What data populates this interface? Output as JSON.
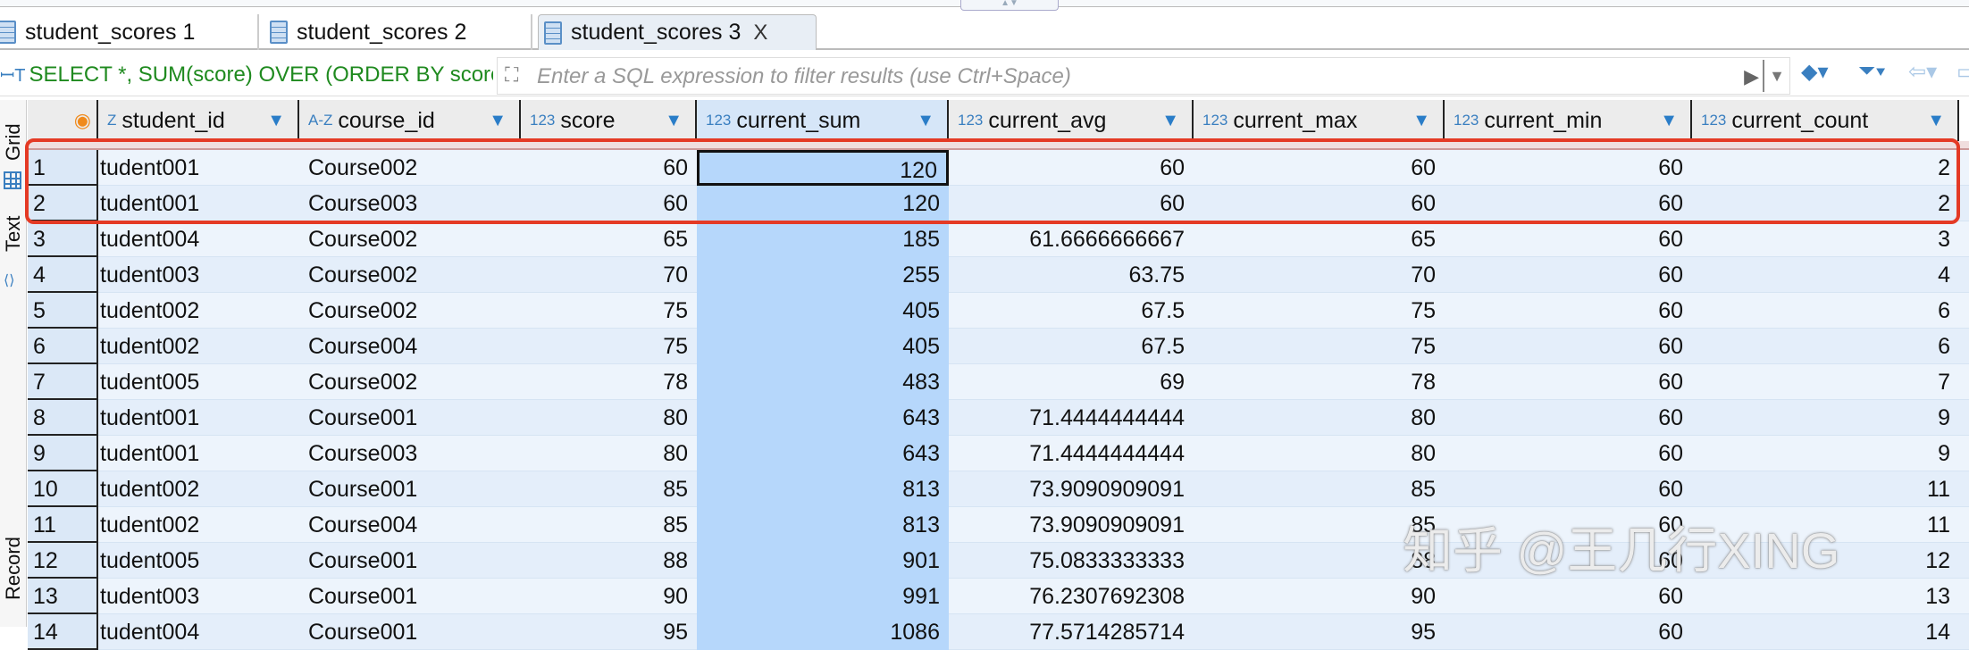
{
  "tabs": [
    {
      "label": "student_scores 1"
    },
    {
      "label": "student_scores 2"
    },
    {
      "label": "student_scores 3",
      "active": true,
      "close": "X"
    }
  ],
  "filter": {
    "sql": "SELECT *, SUM(score) OVER (ORDER BY score",
    "placeholder": "Enter a SQL expression to filter results (use Ctrl+Space)"
  },
  "sidebar": {
    "grid": "Grid",
    "text": "Text",
    "record": "Record"
  },
  "columns": [
    {
      "type": "Z",
      "name": "student_id"
    },
    {
      "type": "A-Z",
      "name": "course_id"
    },
    {
      "type": "123",
      "name": "score"
    },
    {
      "type": "123",
      "name": "current_sum"
    },
    {
      "type": "123",
      "name": "current_avg"
    },
    {
      "type": "123",
      "name": "current_max"
    },
    {
      "type": "123",
      "name": "current_min"
    },
    {
      "type": "123",
      "name": "current_count"
    }
  ],
  "rows": [
    {
      "n": "1",
      "c": [
        "tudent001",
        "Course002",
        "60",
        "120",
        "60",
        "60",
        "60",
        "2"
      ]
    },
    {
      "n": "2",
      "c": [
        "tudent001",
        "Course003",
        "60",
        "120",
        "60",
        "60",
        "60",
        "2"
      ]
    },
    {
      "n": "3",
      "c": [
        "tudent004",
        "Course002",
        "65",
        "185",
        "61.6666666667",
        "65",
        "60",
        "3"
      ]
    },
    {
      "n": "4",
      "c": [
        "tudent003",
        "Course002",
        "70",
        "255",
        "63.75",
        "70",
        "60",
        "4"
      ]
    },
    {
      "n": "5",
      "c": [
        "tudent002",
        "Course002",
        "75",
        "405",
        "67.5",
        "75",
        "60",
        "6"
      ]
    },
    {
      "n": "6",
      "c": [
        "tudent002",
        "Course004",
        "75",
        "405",
        "67.5",
        "75",
        "60",
        "6"
      ]
    },
    {
      "n": "7",
      "c": [
        "tudent005",
        "Course002",
        "78",
        "483",
        "69",
        "78",
        "60",
        "7"
      ]
    },
    {
      "n": "8",
      "c": [
        "tudent001",
        "Course001",
        "80",
        "643",
        "71.4444444444",
        "80",
        "60",
        "9"
      ]
    },
    {
      "n": "9",
      "c": [
        "tudent001",
        "Course003",
        "80",
        "643",
        "71.4444444444",
        "80",
        "60",
        "9"
      ]
    },
    {
      "n": "10",
      "c": [
        "tudent002",
        "Course001",
        "85",
        "813",
        "73.9090909091",
        "85",
        "60",
        "11"
      ]
    },
    {
      "n": "11",
      "c": [
        "tudent002",
        "Course004",
        "85",
        "813",
        "73.9090909091",
        "85",
        "60",
        "11"
      ]
    },
    {
      "n": "12",
      "c": [
        "tudent005",
        "Course001",
        "88",
        "901",
        "75.0833333333",
        "88",
        "60",
        "12"
      ]
    },
    {
      "n": "13",
      "c": [
        "tudent003",
        "Course001",
        "90",
        "991",
        "76.2307692308",
        "90",
        "60",
        "13"
      ]
    },
    {
      "n": "14",
      "c": [
        "tudent004",
        "Course001",
        "95",
        "1086",
        "77.5714285714",
        "95",
        "60",
        "14"
      ]
    }
  ],
  "watermark": "知乎 @王几行XING",
  "colors": {
    "highlight": "#e43a25",
    "selected_column": "#b6d7fb",
    "sql_text": "#1f8a1f"
  }
}
